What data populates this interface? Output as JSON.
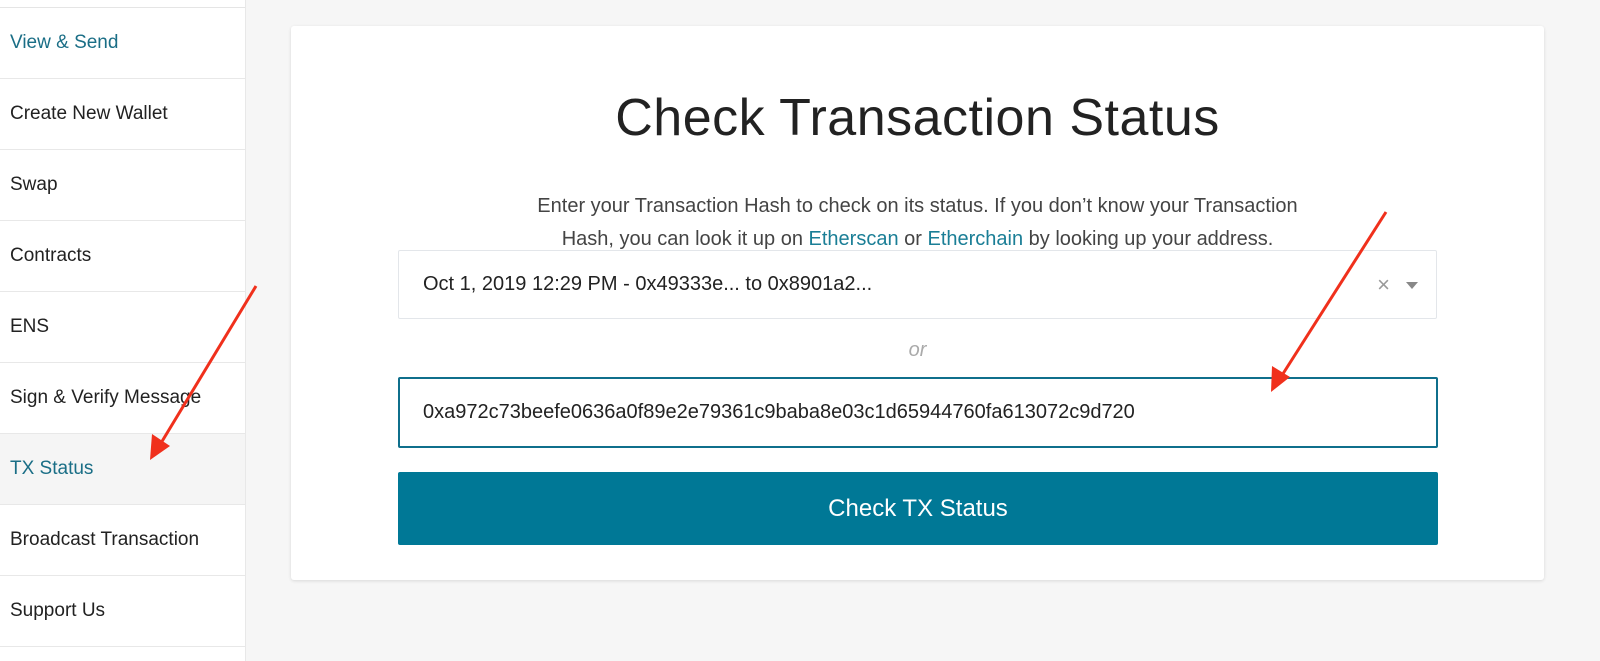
{
  "sidebar": {
    "items": [
      {
        "label": "View & Send",
        "state": "link"
      },
      {
        "label": "Create New Wallet"
      },
      {
        "label": "Swap"
      },
      {
        "label": "Contracts"
      },
      {
        "label": "ENS"
      },
      {
        "label": "Sign & Verify Message"
      },
      {
        "label": "TX Status",
        "state": "active"
      },
      {
        "label": "Broadcast Transaction"
      },
      {
        "label": "Support Us"
      }
    ]
  },
  "main": {
    "title": "Check Transaction Status",
    "desc_1": "Enter your Transaction Hash to check on its status. If you don’t know your Transaction",
    "desc_2": "Hash, you can look it up on ",
    "link_etherscan": "Etherscan",
    "desc_or": " or ",
    "link_etherchain": "Etherchain",
    "desc_3": " by looking up your address.",
    "select_value": "Oct 1, 2019 12:29 PM - 0x49333e... to 0x8901a2...",
    "clear_glyph": "×",
    "or_label": "or",
    "hash_value": "0xa972c73beefe0636a0f89e2e79361c9baba8e03c1d65944760fa613072c9d720",
    "button_label": "Check TX Status"
  },
  "colors": {
    "accent": "#007896",
    "link": "#1a6e86",
    "annotation_arrow": "#f0301c"
  }
}
